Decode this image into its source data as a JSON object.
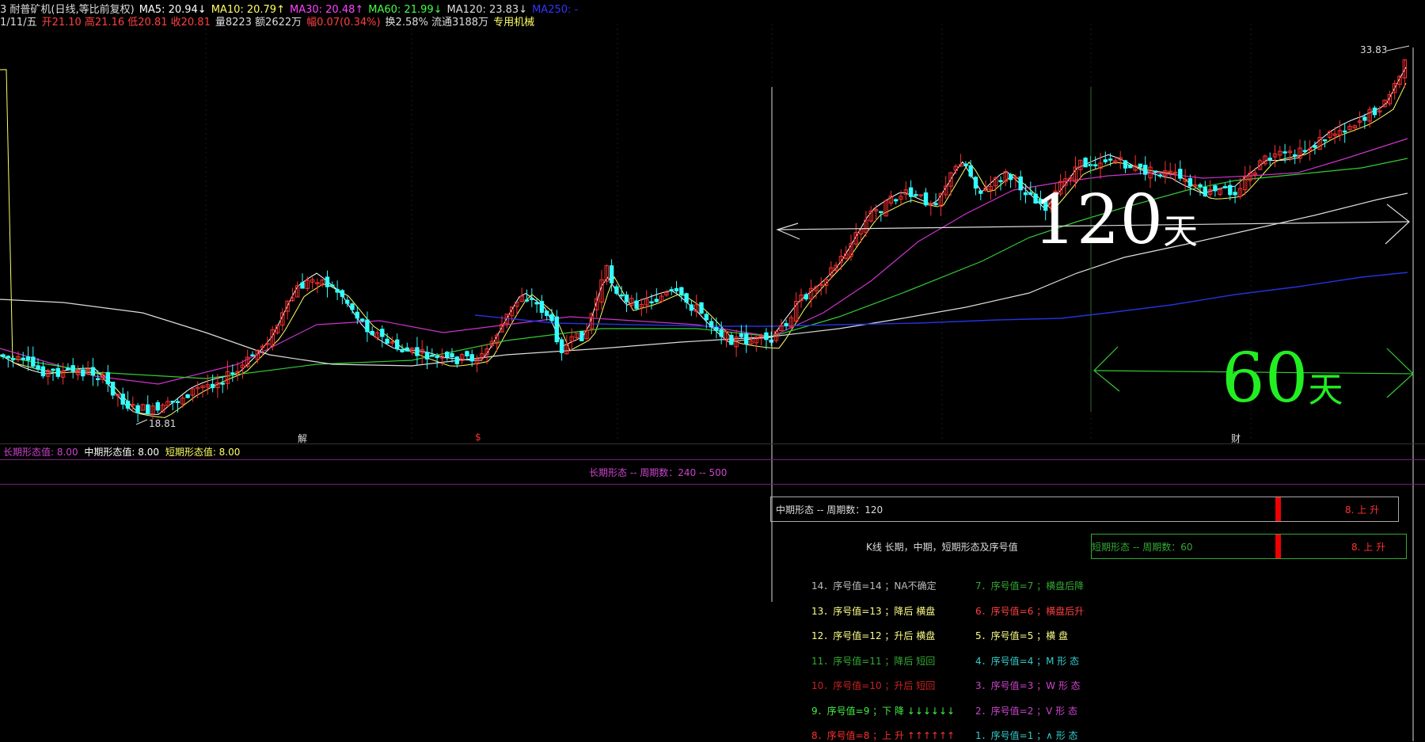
{
  "header": {
    "line1": [
      {
        "text": "3 耐普矿机(日线,等比前复权)",
        "color": "#dddddd"
      },
      {
        "text": "MA5: 20.94↓",
        "color": "#ffffff"
      },
      {
        "text": "MA10: 20.79↑",
        "color": "#ffff66"
      },
      {
        "text": "MA30: 20.48↑",
        "color": "#ff44ff"
      },
      {
        "text": "MA60: 21.99↓",
        "color": "#44ff44"
      },
      {
        "text": "MA120: 23.83↓",
        "color": "#dddddd"
      },
      {
        "text": "MA250: -",
        "color": "#3333ff"
      }
    ],
    "line2": [
      {
        "text": "1/11/五",
        "color": "#dddddd"
      },
      {
        "text": "开21.10 高21.16 低20.81 收20.81",
        "color": "#ff4040"
      },
      {
        "text": "量8223 额2622万",
        "color": "#dddddd"
      },
      {
        "text": "幅0.07(0.34%)",
        "color": "#ff4040"
      },
      {
        "text": "换2.58% 流通3188万",
        "color": "#dddddd"
      },
      {
        "text": "专用机械",
        "color": "#ffff66"
      }
    ]
  },
  "chart": {
    "high_label": "33.83",
    "low_label": "18.81",
    "marker_jie": "解",
    "marker_dollar": "$",
    "marker_cai": "财",
    "span_120_num": "120",
    "span_120_unit": "天",
    "span_60_num": "60",
    "span_60_unit": "天"
  },
  "indicator": {
    "long_value": "长期形态值: 8.00",
    "mid_value": "中期形态值: 8.00",
    "short_value": "短期形态值: 8.00",
    "long_period": "长期形态 -- 周期数：240 -- 500"
  },
  "mid_box": {
    "label": "中期形态 -- 周期数：120",
    "value": "8. 上 升"
  },
  "short_box": {
    "label": "短期形态 -- 周期数：60",
    "value": "8. 上 升"
  },
  "title_text": "K线 长期，中期，短期形态及序号值",
  "legend_left": [
    {
      "text": "14．序号值=14 ；NA不确定",
      "color": "#bbbbbb"
    },
    {
      "text": "13．序号值=13 ；降后 横盘",
      "color": "#ffff88"
    },
    {
      "text": "12．序号值=12 ；升后 横盘",
      "color": "#ffff88"
    },
    {
      "text": "11．序号值=11 ；降后 短回",
      "color": "#33aa33"
    },
    {
      "text": "10．序号值=10 ；升后 短回",
      "color": "#cc2222"
    },
    {
      "text": "9．序号值=9 ；下 降 ↓↓↓↓↓↓",
      "color": "#44ee44"
    },
    {
      "text": "8．序号值=8 ；上 升 ↑↑↑↑↑↑",
      "color": "#ff3030"
    }
  ],
  "legend_right": [
    {
      "text": "7．序号值=7 ；横盘后降",
      "color": "#33aa33"
    },
    {
      "text": "6．序号值=6 ；横盘后升",
      "color": "#ff4040"
    },
    {
      "text": "5．序号值=5 ；横 盘",
      "color": "#ffff88"
    },
    {
      "text": "4．序号值=4 ；M 形 态",
      "color": "#33cccc"
    },
    {
      "text": "3．序号值=3 ；W 形 态",
      "color": "#cc44cc"
    },
    {
      "text": "2．序号值=2 ；V 形 态",
      "color": "#cc44cc"
    },
    {
      "text": "1．序号值=1 ；∧ 形 态",
      "color": "#33cccc"
    }
  ],
  "colors": {
    "up": "#ff3030",
    "down": "#33ffff",
    "ma5": "#ffffff",
    "ma10": "#ffff66",
    "ma30": "#cc33cc",
    "ma60": "#33cc33",
    "ma120": "#dddddd",
    "ma250": "#2233dd"
  }
}
